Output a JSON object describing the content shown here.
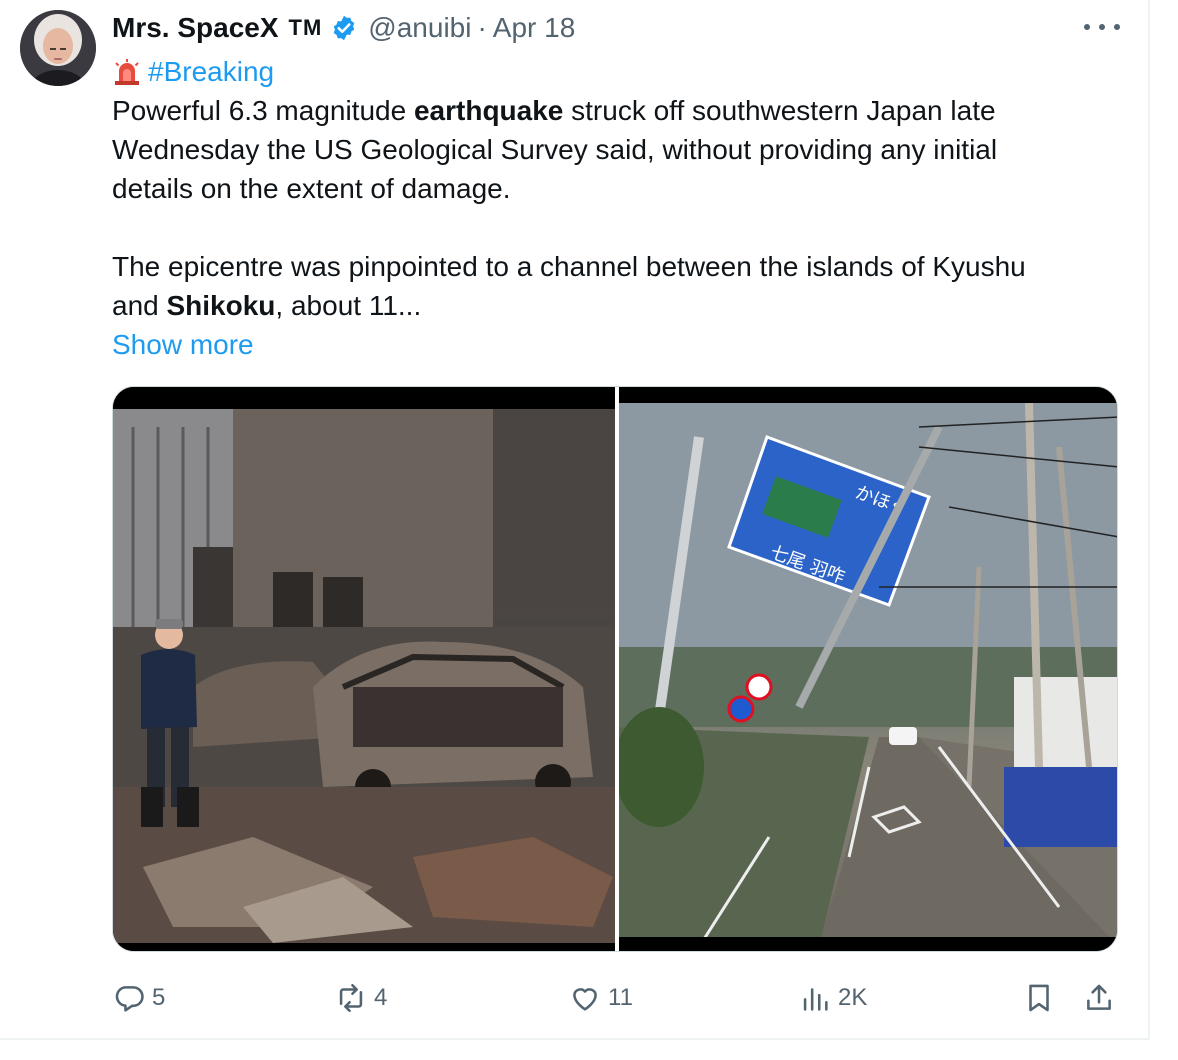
{
  "author": {
    "display_name": "Mrs. SpaceX",
    "tm": "TM",
    "handle": "@anuibi",
    "separator": "·",
    "date": "Apr 18",
    "avatar_icon": "avatar-photo",
    "verified_color": "#1d9bf0"
  },
  "post": {
    "hashtag": "#Breaking",
    "lines": {
      "l1_a": "Powerful 6.3 magnitude ",
      "l1_b": "earthquake",
      "l1_c": " struck off southwestern Japan late",
      "l2": "Wednesday  the US Geological Survey said, without providing any initial",
      "l3": "details on the extent of damage.",
      "l4": "The epicentre was pinpointed to a channel between the islands of Kyushu",
      "l5_a": "and ",
      "l5_b": "Shikoku",
      "l5_c": ", about 11..."
    },
    "show_more": "Show more"
  },
  "media": {
    "left": "earthquake-fire-damage-photo",
    "right": "earthquake-damaged-road-photo"
  },
  "actions": {
    "replies": "5",
    "reposts": "4",
    "likes": "11",
    "views": "2K"
  },
  "colors": {
    "accent": "#1d9bf0",
    "muted": "#536471",
    "text": "#0f1419"
  }
}
